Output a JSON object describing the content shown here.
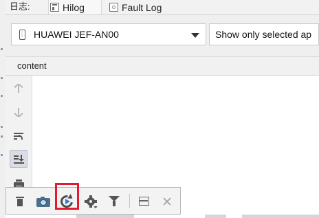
{
  "window": {
    "log_label": "日志:"
  },
  "tabs": [
    {
      "label": "Hilog",
      "icon": "hilog-icon",
      "selected": true
    },
    {
      "label": "Fault Log",
      "icon": "fault-log-icon",
      "selected": false
    }
  ],
  "filters": {
    "device": "HUAWEI JEF-AN00",
    "app_filter": "Show only selected ap"
  },
  "table": {
    "columns": [
      "content"
    ]
  },
  "sidebar_toolbar": [
    {
      "name": "scroll-up-icon",
      "active": false
    },
    {
      "name": "scroll-down-icon",
      "active": false
    },
    {
      "name": "soft-wrap-icon",
      "active": true
    },
    {
      "name": "scroll-to-end-icon",
      "active": true,
      "selected": true
    },
    {
      "name": "print-icon",
      "active": true
    }
  ],
  "bottom_toolbar": [
    {
      "name": "trash-icon"
    },
    {
      "name": "camera-icon"
    },
    {
      "name": "refresh-icon",
      "highlighted": true
    },
    {
      "name": "gear-icon"
    },
    {
      "name": "filter-icon"
    },
    {
      "name": "panel-icon"
    },
    {
      "name": "close-icon"
    }
  ],
  "colors": {
    "highlight_red": "#e31a2d",
    "camera_blue": "#4f6f89",
    "play_blue": "#2d80d7"
  }
}
